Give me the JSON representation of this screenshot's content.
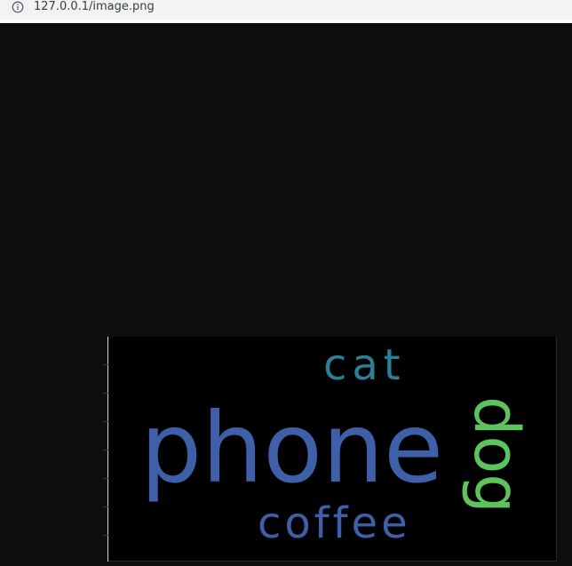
{
  "browser": {
    "url": "127.0.0.1/image.png",
    "info_icon": "info-icon"
  },
  "wordcloud": {
    "words": [
      {
        "text": "phone",
        "color": "#3e60a8"
      },
      {
        "text": "cat",
        "color": "#2b7f97"
      },
      {
        "text": "coffee",
        "color": "#3e60a8"
      },
      {
        "text": "dog",
        "color": "#5dc35c"
      }
    ],
    "background": "#000000"
  }
}
